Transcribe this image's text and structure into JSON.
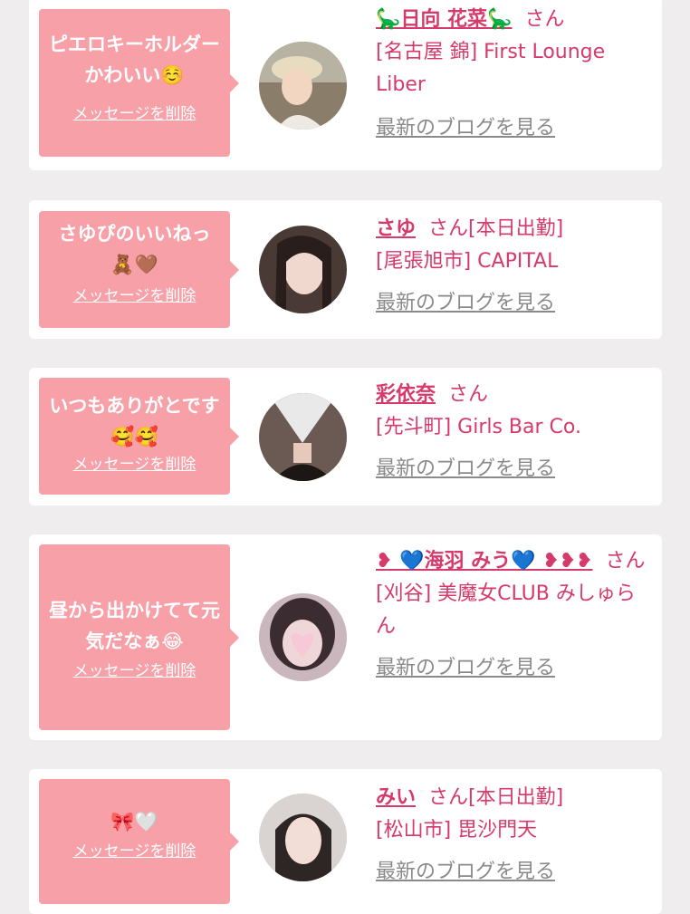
{
  "items": [
    {
      "message": "ピエロキーホルダーかわいい☺️",
      "delete_label": "メッセージを削除",
      "name": "🦕日向 花菜🦕",
      "honorific": "さん",
      "status": "",
      "shop": "[名古屋 錦] First Lounge Liber",
      "blog_label": "最新のブログを見る"
    },
    {
      "message": "さゆぴのいいねっ🧸🤎",
      "delete_label": "メッセージを削除",
      "name": "さゆ",
      "honorific": "さん",
      "status": "[本日出勤]",
      "shop": "[尾張旭市] CAPITAL",
      "blog_label": "最新のブログを見る"
    },
    {
      "message": "いつもありがとです🥰🥰",
      "delete_label": "メッセージを削除",
      "name": "彩依奈",
      "honorific": "さん",
      "status": "",
      "shop": "[先斗町] Girls Bar Co.",
      "blog_label": "最新のブログを見る"
    },
    {
      "message": "昼から出かけてて元気だなぁ😂",
      "delete_label": "メッセージを削除",
      "name": "❥ 💙海羽 みう💙 ❥❥❥",
      "honorific": "さん",
      "status": "",
      "shop": "[刈谷] 美魔女CLUB みしゅらん",
      "blog_label": "最新のブログを見る"
    },
    {
      "message": "🎀🤍",
      "delete_label": "メッセージを削除",
      "name": "みい",
      "honorific": "さん",
      "status": "[本日出勤]",
      "shop": "[松山市] 毘沙門天",
      "blog_label": "最新のブログを見る"
    }
  ]
}
